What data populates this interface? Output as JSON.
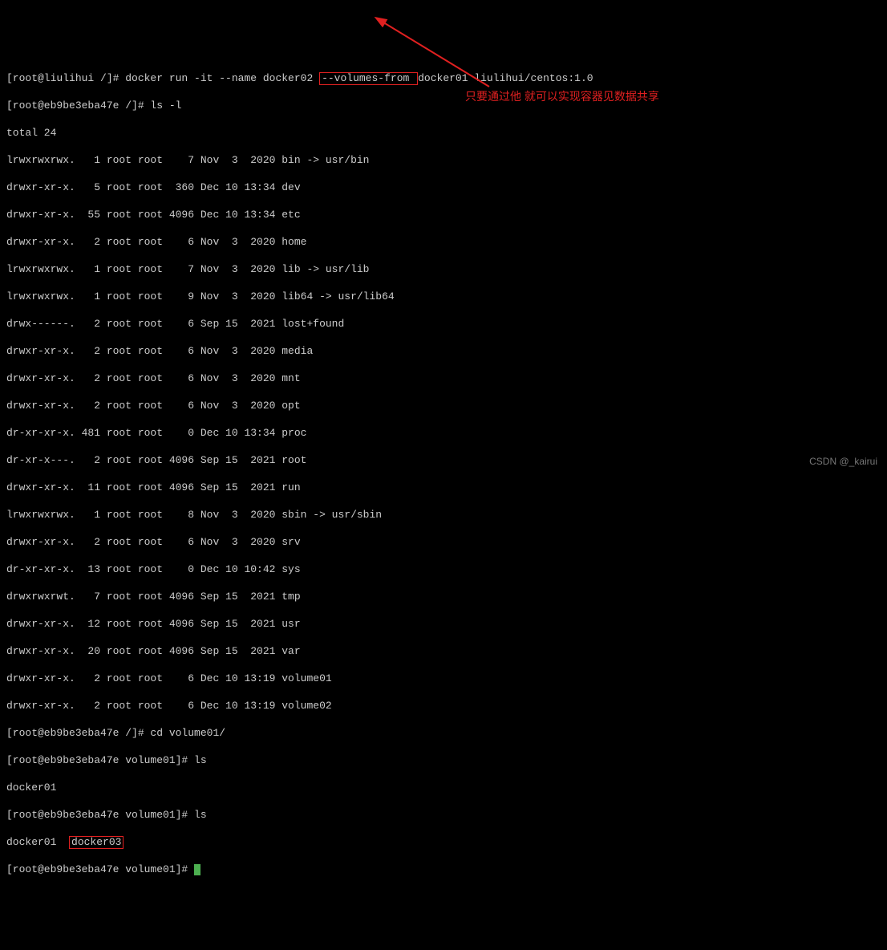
{
  "prompt1": {
    "full_pre": "[root@liulihui /]# docker run -it --name docker02 ",
    "boxed": "--volumes-from ",
    "post": "docker01 liulihui/centos:1.0"
  },
  "prompt2": "[root@eb9be3eba47e /]# ls -l",
  "total_line": "total 24",
  "listing": [
    "lrwxrwxrwx.   1 root root    7 Nov  3  2020 bin -> usr/bin",
    "drwxr-xr-x.   5 root root  360 Dec 10 13:34 dev",
    "drwxr-xr-x.  55 root root 4096 Dec 10 13:34 etc",
    "drwxr-xr-x.   2 root root    6 Nov  3  2020 home",
    "lrwxrwxrwx.   1 root root    7 Nov  3  2020 lib -> usr/lib",
    "lrwxrwxrwx.   1 root root    9 Nov  3  2020 lib64 -> usr/lib64",
    "drwx------.   2 root root    6 Sep 15  2021 lost+found",
    "drwxr-xr-x.   2 root root    6 Nov  3  2020 media",
    "drwxr-xr-x.   2 root root    6 Nov  3  2020 mnt",
    "drwxr-xr-x.   2 root root    6 Nov  3  2020 opt",
    "dr-xr-xr-x. 481 root root    0 Dec 10 13:34 proc",
    "dr-xr-x---.   2 root root 4096 Sep 15  2021 root",
    "drwxr-xr-x.  11 root root 4096 Sep 15  2021 run",
    "lrwxrwxrwx.   1 root root    8 Nov  3  2020 sbin -> usr/sbin",
    "drwxr-xr-x.   2 root root    6 Nov  3  2020 srv",
    "dr-xr-xr-x.  13 root root    0 Dec 10 10:42 sys",
    "drwxrwxrwt.   7 root root 4096 Sep 15  2021 tmp",
    "drwxr-xr-x.  12 root root 4096 Sep 15  2021 usr",
    "drwxr-xr-x.  20 root root 4096 Sep 15  2021 var",
    "drwxr-xr-x.   2 root root    6 Dec 10 13:19 volume01",
    "drwxr-xr-x.   2 root root    6 Dec 10 13:19 volume02"
  ],
  "prompt3": "[root@eb9be3eba47e /]# cd volume01/",
  "prompt4": "[root@eb9be3eba47e volume01]# ls",
  "ls_out1": "docker01",
  "prompt5": "[root@eb9be3eba47e volume01]# ls",
  "ls_out2_pre": "docker01  ",
  "ls_out2_boxed": "docker03",
  "prompt6": "[root@eb9be3eba47e volume01]# ",
  "annotation_text": "只要通过他 就可以实现容器见数据共享",
  "watermark": "CSDN @_kairui"
}
